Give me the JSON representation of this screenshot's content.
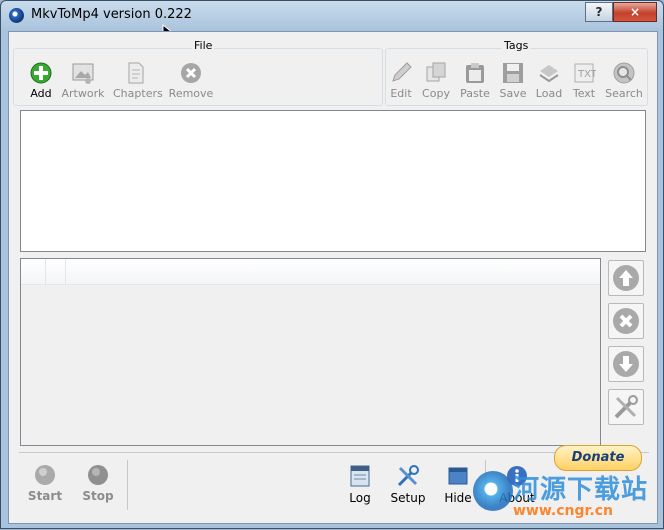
{
  "window": {
    "title": "MkvToMp4 version 0.222",
    "help_label": "?",
    "close_label": "×"
  },
  "file_group": {
    "label": "File",
    "items": [
      {
        "label": "Add",
        "icon": "add-icon",
        "enabled": true
      },
      {
        "label": "Artwork",
        "icon": "artwork-icon",
        "enabled": false
      },
      {
        "label": "Chapters",
        "icon": "chapters-icon",
        "enabled": false
      },
      {
        "label": "Remove",
        "icon": "remove-icon",
        "enabled": false
      }
    ]
  },
  "tags_group": {
    "label": "Tags",
    "items": [
      {
        "label": "Edit",
        "icon": "edit-icon"
      },
      {
        "label": "Copy",
        "icon": "copy-icon"
      },
      {
        "label": "Paste",
        "icon": "paste-icon"
      },
      {
        "label": "Save",
        "icon": "save-icon"
      },
      {
        "label": "Load",
        "icon": "load-icon"
      },
      {
        "label": "Text",
        "icon": "text-icon"
      },
      {
        "label": "Search",
        "icon": "search-icon"
      }
    ]
  },
  "side_buttons": [
    "move-up-icon",
    "remove-track-icon",
    "move-down-icon",
    "settings-tools-icon"
  ],
  "bottom": {
    "start_label": "Start",
    "stop_label": "Stop",
    "log_label": "Log",
    "setup_label": "Setup",
    "hide_label": "Hide",
    "about_label": "About",
    "donate_label": "Donate"
  },
  "watermark": {
    "text": "河源下载站",
    "url": "www.cngr.cn"
  }
}
